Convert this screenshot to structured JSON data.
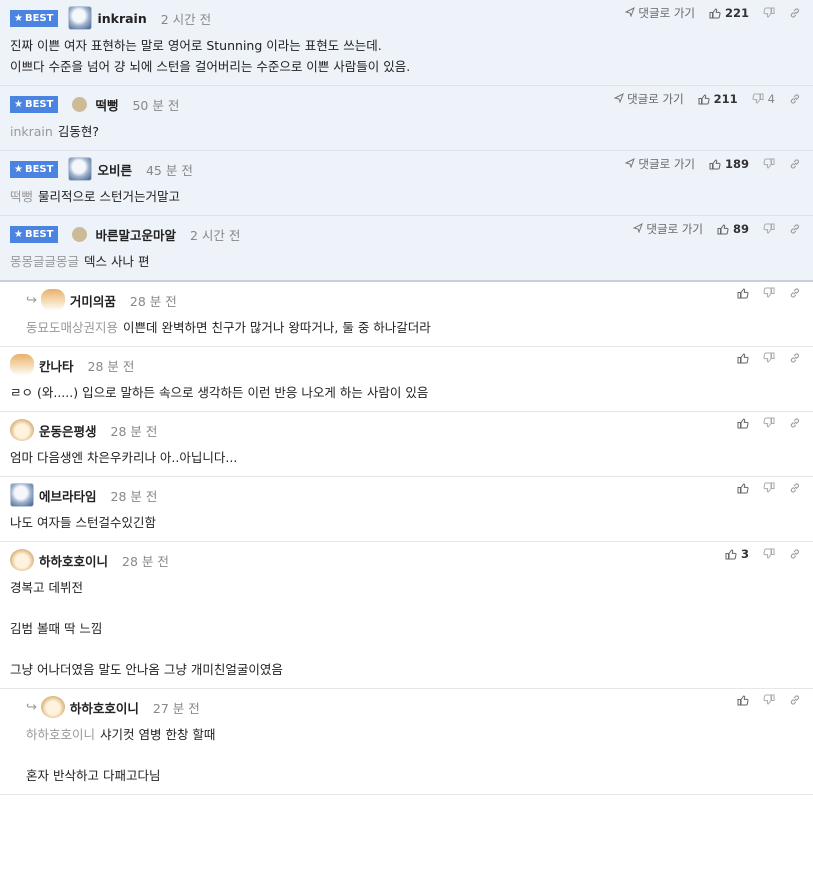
{
  "labels": {
    "best": "BEST",
    "goto": "댓글로 가기"
  },
  "comments": [
    {
      "best": true,
      "reply": false,
      "avatar": "snow-avatar",
      "nick": "inkrain",
      "time": "2 시간 전",
      "likes": "221",
      "dislikes": "",
      "mention": "",
      "lines": [
        "진짜 이쁜 여자 표현하는 말로 영어로 Stunning 이라는 표현도 쓰는데.",
        "이쁘다 수준을 넘어 걍 뇌에 스턴을 걸어버리는 수준으로 이쁜 사람들이 있음."
      ]
    },
    {
      "best": true,
      "reply": false,
      "avatar": "dot-avatar",
      "nick": "떡뻥",
      "time": "50 분 전",
      "likes": "211",
      "dislikes": "4",
      "mention": "inkrain",
      "lines": [
        "김동현?"
      ]
    },
    {
      "best": true,
      "reply": false,
      "avatar": "snow-avatar",
      "nick": "오비른",
      "time": "45 분 전",
      "likes": "189",
      "dislikes": "",
      "mention": "떡뻥",
      "lines": [
        "물리적으로 스턴거는거말고"
      ]
    },
    {
      "best": true,
      "reply": false,
      "avatar": "dot-avatar",
      "nick": "바른말고운마알",
      "time": "2 시간 전",
      "likes": "89",
      "dislikes": "",
      "mention": "몽몽글글몽글",
      "lines": [
        "덱스 사나 편"
      ]
    },
    {
      "best": false,
      "reply": true,
      "avatar": "fox-avatar",
      "nick": "거미의꿈",
      "time": "28 분 전",
      "likes": "",
      "dislikes": "",
      "mention": "동묘도매상권지용",
      "lines": [
        "이쁜데 완벽하면 친구가 많거나 왕따거나, 둘 중 하나갈더라"
      ]
    },
    {
      "best": false,
      "reply": false,
      "avatar": "fox-avatar",
      "nick": "칸나타",
      "time": "28 분 전",
      "likes": "",
      "dislikes": "",
      "mention": "",
      "lines": [
        "ㄹㅇ (와.....) 입으로 말하든 속으로 생각하든 이런 반응 나오게 하는 사람이 있음"
      ]
    },
    {
      "best": false,
      "reply": false,
      "avatar": "dog-avatar",
      "nick": "운동은평생",
      "time": "28 분 전",
      "likes": "",
      "dislikes": "",
      "mention": "",
      "lines": [
        "엄마 다음생엔 차은우카리나 아..아닙니다..."
      ]
    },
    {
      "best": false,
      "reply": false,
      "avatar": "snow-avatar",
      "nick": "에브라타임",
      "time": "28 분 전",
      "likes": "",
      "dislikes": "",
      "mention": "",
      "lines": [
        "나도 여자들 스턴걸수있긴함"
      ]
    },
    {
      "best": false,
      "reply": false,
      "avatar": "dog-avatar",
      "nick": "하하호호이니",
      "time": "28 분 전",
      "likes": "3",
      "dislikes": "",
      "mention": "",
      "lines": [
        "경복고 데뷔전",
        "",
        "김범 볼때 딱 느낌",
        "",
        "그냥 어나더였음 말도 안나옴 그냥 개미친얼굴이였음"
      ]
    },
    {
      "best": false,
      "reply": true,
      "avatar": "dog-avatar",
      "nick": "하하호호이니",
      "time": "27 분 전",
      "likes": "",
      "dislikes": "",
      "mention": "하하호호이니",
      "lines": [
        "샤기컷 염병 한창 할때",
        "",
        "혼자 반삭하고 다패고다님"
      ]
    }
  ],
  "colors": {
    "best_bg": "#eef2f9",
    "badge": "#4a84e0",
    "mention": "#999999"
  }
}
